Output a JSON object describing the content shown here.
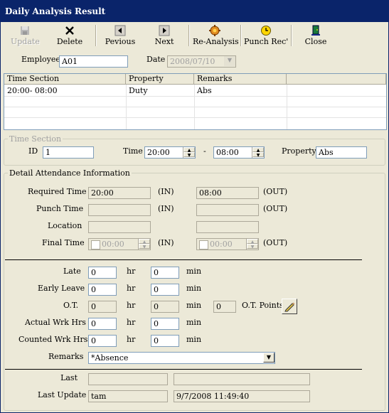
{
  "window": {
    "title": "Daily Analysis Result"
  },
  "toolbar": {
    "update": "Update",
    "delete": "Delete",
    "previous": "Pevious",
    "next": "Next",
    "reanalysis": "Re-Analysis",
    "punch_rec": "Punch Rec'",
    "close": "Close"
  },
  "header": {
    "employee_label": "Employee",
    "employee_value": "A01",
    "date_label": "Date",
    "date_value": "2008/07/10"
  },
  "grid": {
    "columns": [
      "Time Section",
      "Property",
      "Remarks"
    ],
    "rows": [
      [
        "20:00- 08:00",
        "Duty",
        "Abs"
      ]
    ]
  },
  "time_section": {
    "title": "Time Section",
    "id_label": "ID",
    "id_value": "1",
    "time_label": "Time",
    "time_from": "20:00",
    "dash": "-",
    "time_to": "08:00",
    "property_label": "Property",
    "property_value": "Abs"
  },
  "detail": {
    "title": "Detail Attendance Information",
    "required_time_label": "Required Time",
    "required_in": "20:00",
    "required_out": "08:00",
    "in_label": "(IN)",
    "out_label": "(OUT)",
    "punch_time_label": "Punch Time",
    "punch_in": "",
    "punch_out": "",
    "location_label": "Location",
    "location_in": "",
    "location_out": "",
    "final_time_label": "Final Time",
    "final_in": "00:00",
    "final_out": "00:00",
    "late_label": "Late",
    "early_leave_label": "Early Leave",
    "ot_label": "O.T.",
    "actual_label": "Actual Wrk Hrs",
    "counted_label": "Counted Wrk Hrs",
    "hr_label": "hr",
    "min_label": "min",
    "late_hr": "0",
    "late_min": "0",
    "early_hr": "0",
    "early_min": "0",
    "ot_hr": "0",
    "ot_min": "0",
    "ot_points_value": "0",
    "ot_points_label": "O.T. Points",
    "actual_hr": "0",
    "actual_min": "0",
    "counted_hr": "0",
    "counted_min": "0",
    "remarks_label": "Remarks",
    "remarks_value": "*Absence",
    "last_approval_label": "Last Approval",
    "last_approval_user": "",
    "last_approval_time": "",
    "last_update_label": "Last Update",
    "last_update_user": "tam",
    "last_update_time": "9/7/2008 11:49:40"
  },
  "colors": {
    "titlebar": "#0a246a",
    "face": "#ece9d8",
    "field_border": "#7f9db9"
  }
}
